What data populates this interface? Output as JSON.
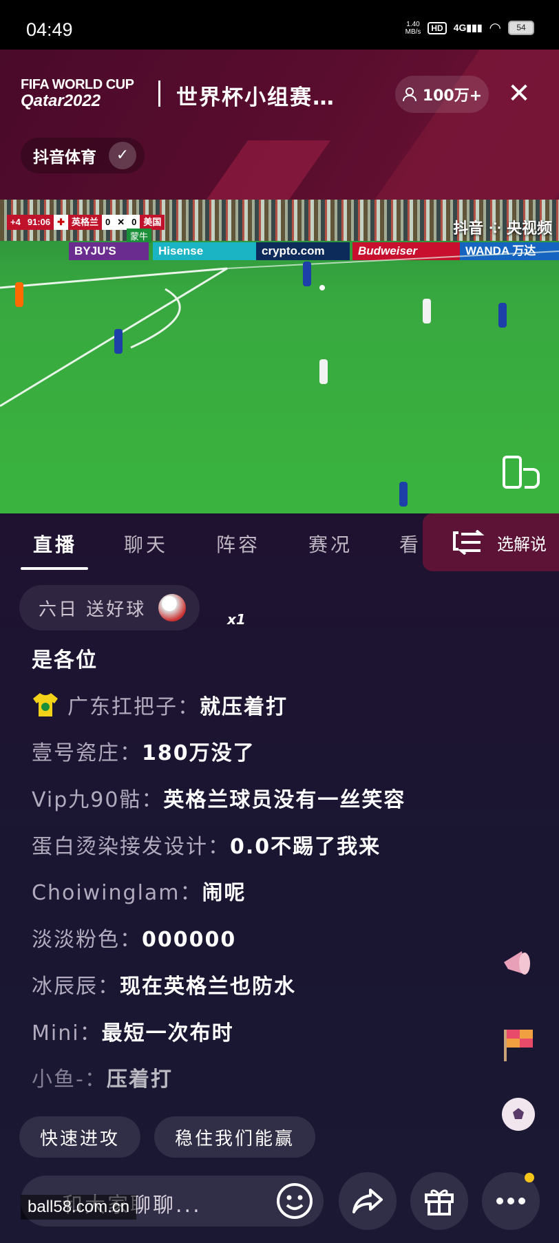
{
  "status_bar": {
    "time": "04:49",
    "net_speed_value": "1.40",
    "net_speed_unit": "MB/s",
    "hd": "HD",
    "network": "4G",
    "battery": "54"
  },
  "header": {
    "logo_line1": "FIFA WORLD CUP",
    "logo_line2": "Qatar2022",
    "title": "世界杯小组赛…",
    "viewers": "100万+",
    "channel_name": "抖音体育"
  },
  "video": {
    "scorebug": {
      "added_time": "+4",
      "clock": "91:06",
      "team1": "英格兰",
      "score1": "0",
      "score2": "0",
      "team2": "美国",
      "sponsor": "蒙牛"
    },
    "broadcaster_watermark": "抖音 ⁘ 央视频",
    "boards": [
      "BYJU'S",
      "Hisense",
      "crypto.com",
      "Budweiser",
      "WANDA 万达"
    ]
  },
  "tabs": [
    {
      "label": "直播",
      "active": true
    },
    {
      "label": "聊天",
      "active": false
    },
    {
      "label": "阵容",
      "active": false
    },
    {
      "label": "赛况",
      "active": false
    },
    {
      "label": "看",
      "active": false
    }
  ],
  "commentary_button": "选解说",
  "gift_banner": {
    "text": "六日 送好球",
    "count": "x1"
  },
  "chat": [
    {
      "name": "",
      "text": "是各位"
    },
    {
      "name": "广东扛把子：",
      "text": "就压着打",
      "badge": "jersey-icon"
    },
    {
      "name": "壹号瓷庄：",
      "text": "180万没了"
    },
    {
      "name": "Vip九90骷：",
      "text": "英格兰球员没有一丝笑容"
    },
    {
      "name": "蛋白烫染接发设计：",
      "text": "0.0不踢了我来"
    },
    {
      "name": "Choiwinglam：",
      "text": "闹呢"
    },
    {
      "name": "淡淡粉色：",
      "text": "000000"
    },
    {
      "name": "冰辰辰：",
      "text": "现在英格兰也防水"
    },
    {
      "name": "Mini：",
      "text": "最短一次布时"
    },
    {
      "name": "小鱼-：",
      "text": "压着打"
    }
  ],
  "quick_replies": [
    "快速进攻",
    "稳住我们能赢"
  ],
  "input_placeholder": "和大家聊聊...",
  "site_watermark": "ball58.com.cn",
  "colors": {
    "header_bg": "#5a0d2e",
    "accent_stripe": "#8b1a3e",
    "pitch_green": "#37a83f",
    "notification_dot": "#f5c518"
  }
}
